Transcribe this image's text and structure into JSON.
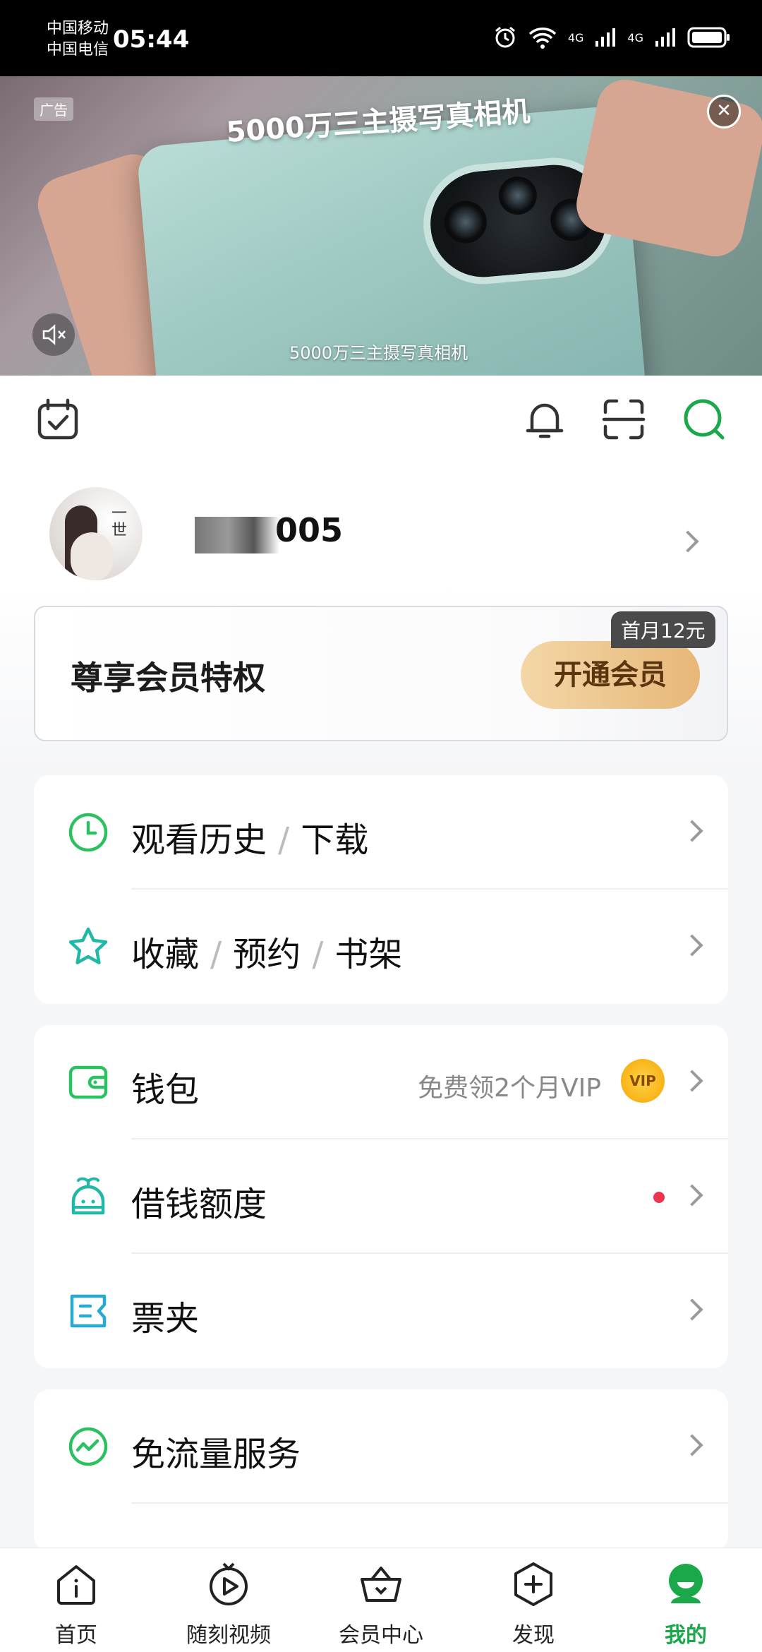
{
  "status_bar": {
    "carrier1": "中国移动",
    "carrier2": "中国电信",
    "time": "05:44",
    "network1": "4G",
    "network2": "4G",
    "wifi_label": "6"
  },
  "ad": {
    "tag": "广告",
    "title": "5000万三主摄写真相机",
    "subtitle": "5000万三主摄写真相机",
    "close_icon": "close-icon",
    "mute_icon": "mute-icon"
  },
  "topbar": {
    "icons": [
      "calendar-check-icon",
      "bell-icon",
      "scan-icon",
      "search-icon"
    ],
    "accent": "#1aa84a"
  },
  "profile": {
    "username": "005"
  },
  "vip_card": {
    "title": "尊享会员特权",
    "button": "开通会员",
    "badge": "首月12元"
  },
  "card1": {
    "rows": [
      {
        "label_a": "观看历史",
        "sep": "/",
        "label_b": "下载"
      },
      {
        "label_a": "收藏",
        "sep": "/",
        "label_b": "预约",
        "sep2": "/",
        "label_c": "书架"
      }
    ]
  },
  "card2": {
    "rows": [
      {
        "label": "钱包",
        "hint": "免费领2个月VIP",
        "badge": "VIP"
      },
      {
        "label": "借钱额度"
      },
      {
        "label": "票夹"
      }
    ]
  },
  "card3": {
    "rows": [
      {
        "label": "免流量服务"
      }
    ]
  },
  "bottom_nav": {
    "items": [
      {
        "label": "首页",
        "icon": "home-icon"
      },
      {
        "label": "随刻视频",
        "icon": "play-icon"
      },
      {
        "label": "会员中心",
        "icon": "crown-basket-icon"
      },
      {
        "label": "发现",
        "icon": "plus-hex-icon"
      },
      {
        "label": "我的",
        "icon": "profile-icon"
      }
    ],
    "active_index": 4,
    "active_color": "#1aa84a"
  }
}
